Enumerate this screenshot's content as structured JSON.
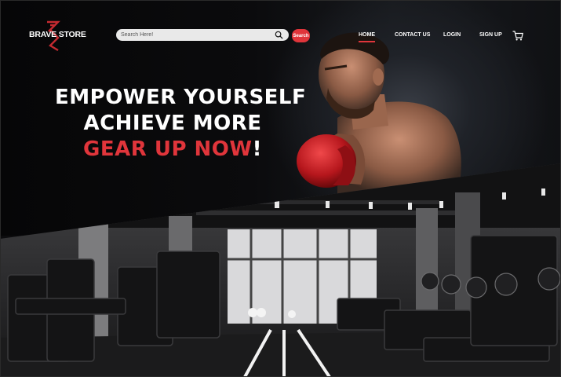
{
  "brand": {
    "name": "BRAVE STORE",
    "accent": "#e0353b"
  },
  "search": {
    "placeholder": "Search Here!",
    "button_label": "Search"
  },
  "nav": {
    "items": [
      {
        "label": "HOME",
        "active": true
      },
      {
        "label": "CONTACT US"
      },
      {
        "label": "LOGIN"
      },
      {
        "label": "SIGN UP"
      }
    ],
    "cart_icon": "shopping-cart-icon"
  },
  "hero": {
    "line1": "EMPOWER YOURSELF",
    "line2": "ACHIEVE MORE",
    "line3_highlight": "GEAR UP NOW",
    "line3_suffix": "!"
  }
}
